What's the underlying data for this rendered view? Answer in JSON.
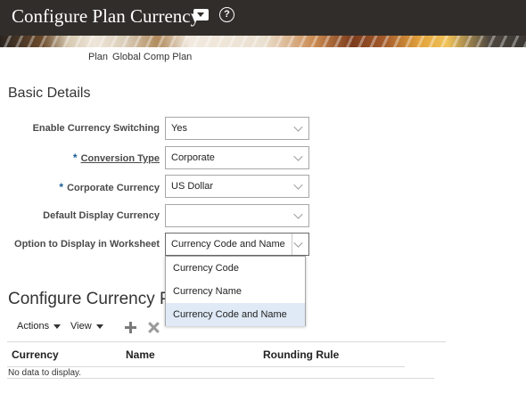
{
  "header": {
    "title": "Configure Plan Currency",
    "menu_icon": "dropdown-menu-icon",
    "help_icon": "help-icon",
    "help_glyph": "?"
  },
  "plan": {
    "label": "Plan",
    "value": "Global Comp Plan"
  },
  "basic_details": {
    "title": "Basic Details",
    "fields": [
      {
        "label": "Enable Currency Switching",
        "value": "Yes",
        "required": false
      },
      {
        "label": "Conversion Type",
        "value": "Corporate",
        "required": true
      },
      {
        "label": "Corporate Currency",
        "value": "US Dollar",
        "required": true
      },
      {
        "label": "Default Display Currency",
        "value": "",
        "required": false
      },
      {
        "label": "Option to Display in Worksheet",
        "value": "Currency Code and Name",
        "required": false
      }
    ],
    "required_marker": "*"
  },
  "worksheet_dropdown": {
    "options": [
      "Currency Code",
      "Currency Name",
      "Currency Code and Name"
    ],
    "selected_index": 2
  },
  "currency_section": {
    "title": "Configure Currency Pr",
    "toolbar": {
      "actions_label": "Actions",
      "view_label": "View",
      "add_icon": "plus-icon",
      "remove_icon": "close-icon"
    },
    "columns": [
      "Currency",
      "Name",
      "Rounding Rule"
    ],
    "empty_text": "No data to display."
  },
  "colors": {
    "header_bg": "#312d2a",
    "selected_option_bg": "#dfeaf6",
    "required_marker": "#1a5b95"
  }
}
